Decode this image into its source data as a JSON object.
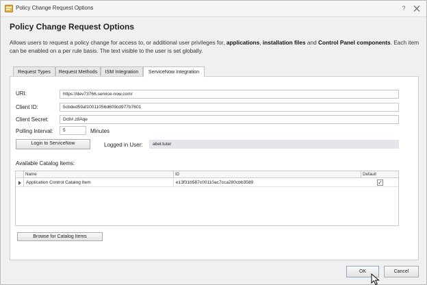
{
  "window": {
    "title": "Policy Change Request Options",
    "help_glyph": "?"
  },
  "header": {
    "heading": "Policy Change Request Options",
    "description_parts": [
      "Allows users to request a policy change for access to, or additional user privileges for, ",
      "applications",
      ", ",
      "installation files",
      " and ",
      "Control Panel components",
      ". Each item can be enabled on a per rule basis. The text visible to the user is set globally."
    ]
  },
  "tabs": [
    {
      "label": "Request Types",
      "active": false
    },
    {
      "label": "Request Methods",
      "active": false
    },
    {
      "label": "ISM Integration",
      "active": false
    },
    {
      "label": "ServiceNow Integration",
      "active": true
    }
  ],
  "form": {
    "uri_label": "URI:",
    "uri_value": "https://dev73766.service-now.com/",
    "client_id_label": "Client ID:",
    "client_id_value": "5cbded59af10011056d609cd977b7601",
    "client_secret_label": "Client Secret:",
    "client_secret_value": "Dc8#.z8Aqe",
    "polling_label": "Polling Interval:",
    "polling_value": "5",
    "polling_unit": "Minutes",
    "login_button": "Login to ServiceNow",
    "logged_in_label": "Logged in User:",
    "logged_in_value": "abel.tuter"
  },
  "catalog": {
    "section_label": "Available Catalog Items:",
    "columns": [
      "Name",
      "ID",
      "Default"
    ],
    "rows": [
      {
        "name": "Application Control Catalog Item",
        "id": "e13f31b587c00110ac7cca280cbb3589",
        "default_checked": true,
        "check_glyph": "✓"
      }
    ],
    "browse_button": "Browse for Catalog Items"
  },
  "footer": {
    "ok_button": "OK",
    "cancel_button": "Cancel"
  }
}
